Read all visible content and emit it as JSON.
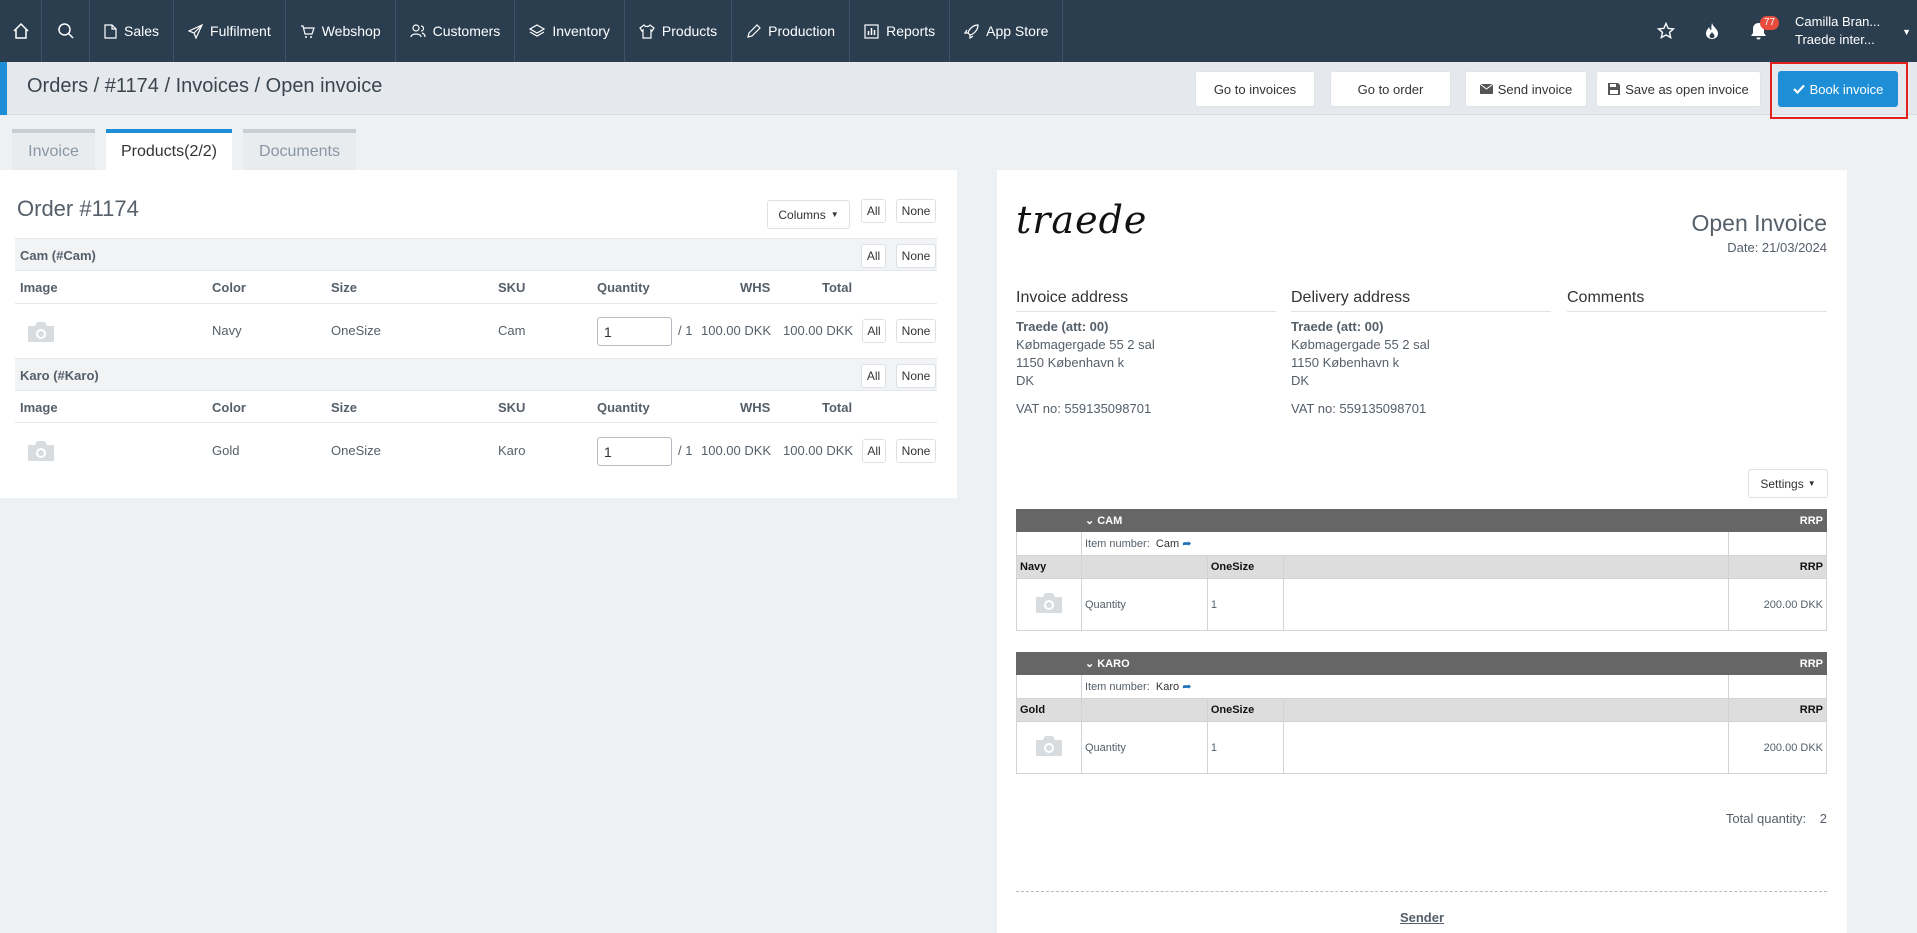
{
  "nav": {
    "items": [
      {
        "label": "Sales",
        "icon": "file-icon"
      },
      {
        "label": "Fulfilment",
        "icon": "paper-plane-icon"
      },
      {
        "label": "Webshop",
        "icon": "cart-icon"
      },
      {
        "label": "Customers",
        "icon": "users-icon"
      },
      {
        "label": "Inventory",
        "icon": "layers-icon"
      },
      {
        "label": "Products",
        "icon": "tshirt-icon"
      },
      {
        "label": "Production",
        "icon": "pencil-icon"
      },
      {
        "label": "Reports",
        "icon": "bar-chart-icon"
      },
      {
        "label": "App Store",
        "icon": "rocket-icon"
      }
    ],
    "notification_count": "77",
    "user_name": "Camilla Bran...",
    "user_company": "Traede inter..."
  },
  "header": {
    "breadcrumb": "Orders / #1174 / Invoices / Open invoice",
    "go_to_invoices": "Go to invoices",
    "go_to_order": "Go to order",
    "send_invoice": "Send invoice",
    "save_open": "Save as open invoice",
    "book_invoice": "Book invoice"
  },
  "tabs": {
    "invoice": "Invoice",
    "products": "Products(2/2)",
    "documents": "Documents"
  },
  "order": {
    "title": "Order #1174",
    "columns_label": "Columns",
    "all_label": "All",
    "none_label": "None",
    "headers": {
      "image": "Image",
      "color": "Color",
      "size": "Size",
      "sku": "SKU",
      "quantity": "Quantity",
      "whs": "WHS",
      "total": "Total"
    },
    "groups": [
      {
        "name": "Cam (#Cam)",
        "color": "Navy",
        "size": "OneSize",
        "sku": "Cam",
        "qty": "1",
        "of": "/ 1",
        "whs": "100.00 DKK",
        "total": "100.00 DKK"
      },
      {
        "name": "Karo (#Karo)",
        "color": "Gold",
        "size": "OneSize",
        "sku": "Karo",
        "qty": "1",
        "of": "/ 1",
        "whs": "100.00 DKK",
        "total": "100.00 DKK"
      }
    ]
  },
  "invoice": {
    "logo": "traede",
    "title": "Open Invoice",
    "date": "Date: 21/03/2024",
    "invoice_address_label": "Invoice address",
    "delivery_address_label": "Delivery address",
    "comments_label": "Comments",
    "address": {
      "name": "Traede (att: 00)",
      "street": "Købmagergade 55 2 sal",
      "city": "1150 København k",
      "country": "DK",
      "vat": "VAT no: 559135098701"
    },
    "settings_label": "Settings",
    "rrp_label": "RRP",
    "item_number_label": "Item number:",
    "quantity_label": "Quantity",
    "products": [
      {
        "name": "CAM",
        "item_number": "Cam",
        "color": "Navy",
        "size": "OneSize",
        "qty": "1",
        "price": "200.00 DKK"
      },
      {
        "name": "KARO",
        "item_number": "Karo",
        "color": "Gold",
        "size": "OneSize",
        "qty": "1",
        "price": "200.00 DKK"
      }
    ],
    "total_quantity_label": "Total quantity:",
    "total_quantity": "2",
    "sender_label": "Sender"
  },
  "colors": {
    "nav_bg": "#2b3e50",
    "primary": "#1e8fd6",
    "badge": "#e74c3c",
    "highlight": "#e22020"
  }
}
